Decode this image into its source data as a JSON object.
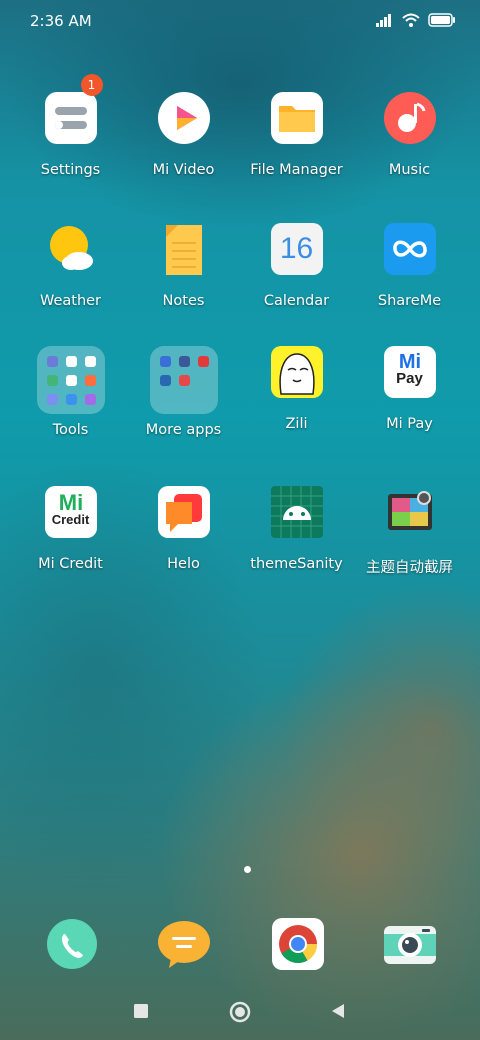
{
  "status_bar": {
    "time": "2:36 AM",
    "icons": [
      "signal-icon",
      "wifi-icon",
      "battery-icon"
    ]
  },
  "apps": [
    {
      "label": "Settings",
      "icon": "settings-icon",
      "badge": "1"
    },
    {
      "label": "Mi Video",
      "icon": "mi-video-icon"
    },
    {
      "label": "File Manager",
      "icon": "file-manager-icon"
    },
    {
      "label": "Music",
      "icon": "music-icon"
    },
    {
      "label": "Weather",
      "icon": "weather-icon"
    },
    {
      "label": "Notes",
      "icon": "notes-icon"
    },
    {
      "label": "Calendar",
      "icon": "calendar-icon",
      "icon_text": "16"
    },
    {
      "label": "ShareMe",
      "icon": "shareme-icon"
    },
    {
      "label": "Tools",
      "icon": "folder-icon"
    },
    {
      "label": "More apps",
      "icon": "folder-icon"
    },
    {
      "label": "Zili",
      "icon": "zili-icon"
    },
    {
      "label": "Mi Pay",
      "icon": "mi-pay-icon",
      "icon_text": "Pay"
    },
    {
      "label": "Mi Credit",
      "icon": "mi-credit-icon",
      "icon_text": "Credit"
    },
    {
      "label": "Helo",
      "icon": "helo-icon"
    },
    {
      "label": "themeSanity",
      "icon": "android-icon"
    },
    {
      "label": "主题自动截屏",
      "icon": "screenshot-app-icon"
    }
  ],
  "dock": [
    {
      "icon": "phone-icon"
    },
    {
      "icon": "messages-icon"
    },
    {
      "icon": "chrome-icon"
    },
    {
      "icon": "camera-icon"
    }
  ],
  "nav": {
    "buttons": [
      "recents-button",
      "home-button",
      "back-button"
    ]
  }
}
